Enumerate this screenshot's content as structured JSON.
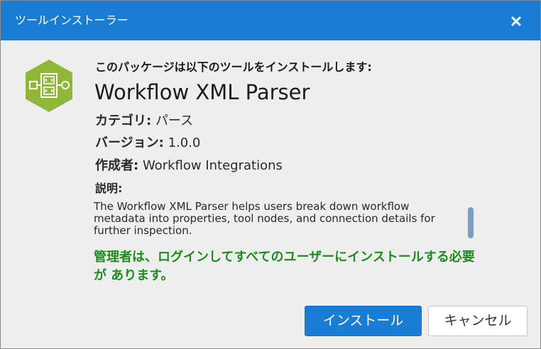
{
  "window": {
    "title": "ツールインストーラー",
    "close_symbol": "x",
    "title_bar_color": "#1a7dd4"
  },
  "package": {
    "heading": "このパッケージは以下のツールをインストールします:",
    "icon": "workflow-xml-hexagon-icon",
    "icon_color": "#8fb83a",
    "name": "Workflow XML Parser",
    "category_label": "カテゴリ:",
    "category_value": "パース",
    "version_label": "バージョン:",
    "version_value": "1.0.0",
    "author_label": "作成者:",
    "author_value": "Workflow Integrations",
    "description_label": "説明:",
    "description": "The Workflow XML Parser helps users break down workflow metadata into properties, tool nodes, and connection details for further inspection."
  },
  "admin_note": "管理者は、ログインしてすべてのユーザーにインストールする必要が あります。",
  "admin_note_color": "#1f8a1f",
  "buttons": {
    "install": "インストール",
    "cancel": "キャンセル"
  }
}
